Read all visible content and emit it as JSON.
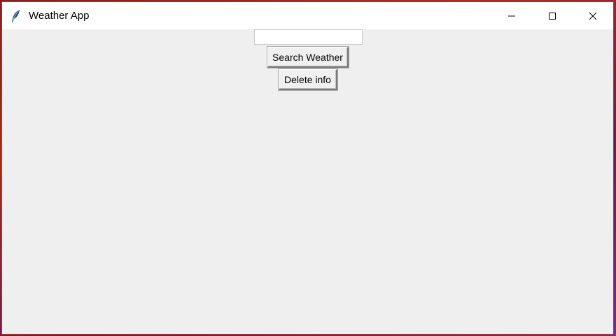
{
  "window": {
    "title": "Weather App",
    "icon": "feather-icon"
  },
  "titlebar_controls": {
    "minimize": "minimize-icon",
    "maximize": "maximize-icon",
    "close": "close-icon"
  },
  "search": {
    "value": "",
    "placeholder": ""
  },
  "buttons": {
    "search_label": "Search Weather",
    "delete_label": "Delete info"
  }
}
